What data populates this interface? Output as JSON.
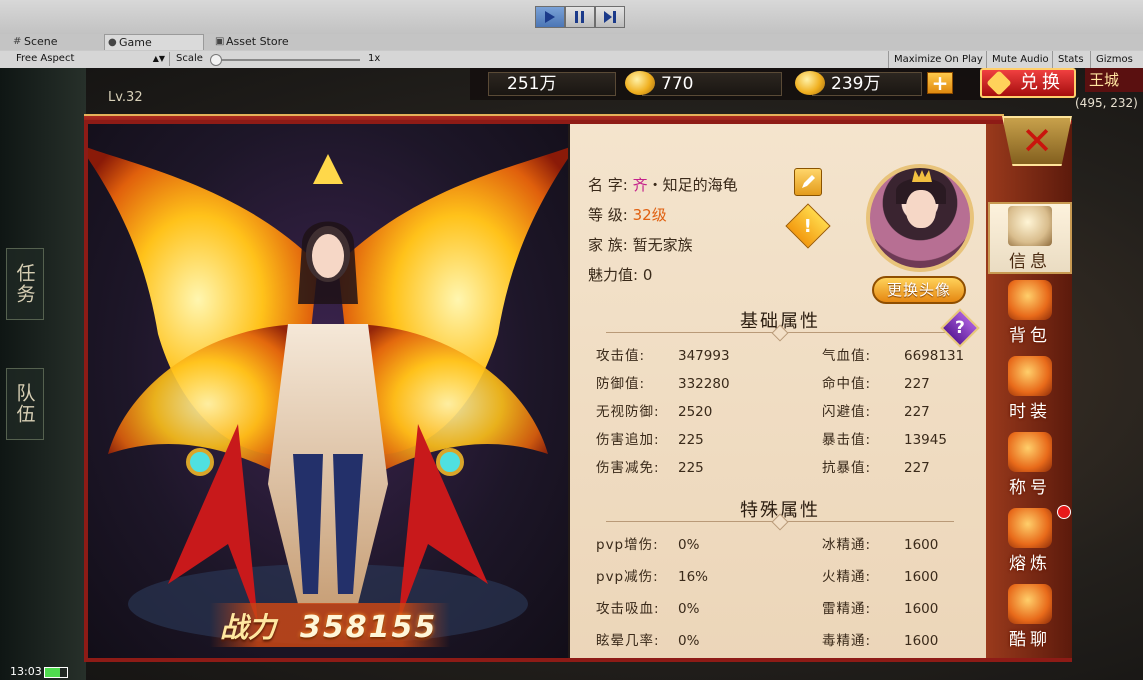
{
  "editor": {
    "tabs": [
      {
        "label": "Scene",
        "icon": "grid-icon"
      },
      {
        "label": "Game",
        "icon": "game-controller-icon"
      },
      {
        "label": "Asset Store",
        "icon": "store-icon"
      }
    ],
    "aspect": "Free Aspect",
    "scale_label": "Scale",
    "scale_value": "1x",
    "toolbar_right": [
      "Maximize On Play",
      "Mute Audio",
      "Stats",
      "Gizmos"
    ]
  },
  "hud": {
    "player_level": "Lv.32",
    "resources": [
      {
        "value": "251万",
        "icon": "silver-ingot-icon"
      },
      {
        "value": "770",
        "icon": "gold-ingot-icon"
      },
      {
        "value": "239万",
        "icon": "gold-sycee-icon"
      }
    ],
    "plus_label": "+",
    "exchange_label": "兑换",
    "map_name": "王城",
    "coords": "(495, 232)",
    "side_left": [
      "任务",
      "队伍"
    ],
    "time": "13:03",
    "battery_level": 0.7
  },
  "profile": {
    "name_label": "名  字:",
    "name_prefix": "齐",
    "name_separator": "・",
    "name": "知足的海龟",
    "level_label": "等  级:",
    "level": "32级",
    "family_label": "家    族:",
    "family": "暂无家族",
    "charm_label": "魅力值:",
    "charm": "0",
    "change_avatar": "更换头像"
  },
  "basic_title": "基础属性",
  "basic_stats": [
    {
      "label": "攻击值:",
      "value": "347993"
    },
    {
      "label": "气血值:",
      "value": "6698131"
    },
    {
      "label": "防御值:",
      "value": "332280"
    },
    {
      "label": "命中值:",
      "value": "227"
    },
    {
      "label": "无视防御:",
      "value": "2520"
    },
    {
      "label": "闪避值:",
      "value": "227"
    },
    {
      "label": "伤害追加:",
      "value": "225"
    },
    {
      "label": "暴击值:",
      "value": "13945"
    },
    {
      "label": "伤害减免:",
      "value": "225"
    },
    {
      "label": "抗暴值:",
      "value": "227"
    }
  ],
  "special_title": "特殊属性",
  "special_stats": [
    {
      "label": "pvp增伤:",
      "value": "0%"
    },
    {
      "label": "冰精通:",
      "value": "1600"
    },
    {
      "label": "pvp减伤:",
      "value": "16%"
    },
    {
      "label": "火精通:",
      "value": "1600"
    },
    {
      "label": "攻击吸血:",
      "value": "0%"
    },
    {
      "label": "雷精通:",
      "value": "1600"
    },
    {
      "label": "眩晕几率:",
      "value": "0%"
    },
    {
      "label": "毒精通:",
      "value": "1600"
    }
  ],
  "side_tabs": [
    {
      "label": "信息",
      "icon": "scroll-icon"
    },
    {
      "label": "背包",
      "icon": "bag-icon"
    },
    {
      "label": "时装",
      "icon": "fashion-icon"
    },
    {
      "label": "称号",
      "icon": "title-badge-icon"
    },
    {
      "label": "熔炼",
      "icon": "smelt-icon"
    },
    {
      "label": "酷聊",
      "icon": "chat-icon"
    }
  ],
  "power": {
    "label": "战力",
    "value": "358155"
  },
  "colors": {
    "panel_red": "#8e1b16",
    "gold": "#e8c37a",
    "parchment": "#f4e4cd"
  }
}
